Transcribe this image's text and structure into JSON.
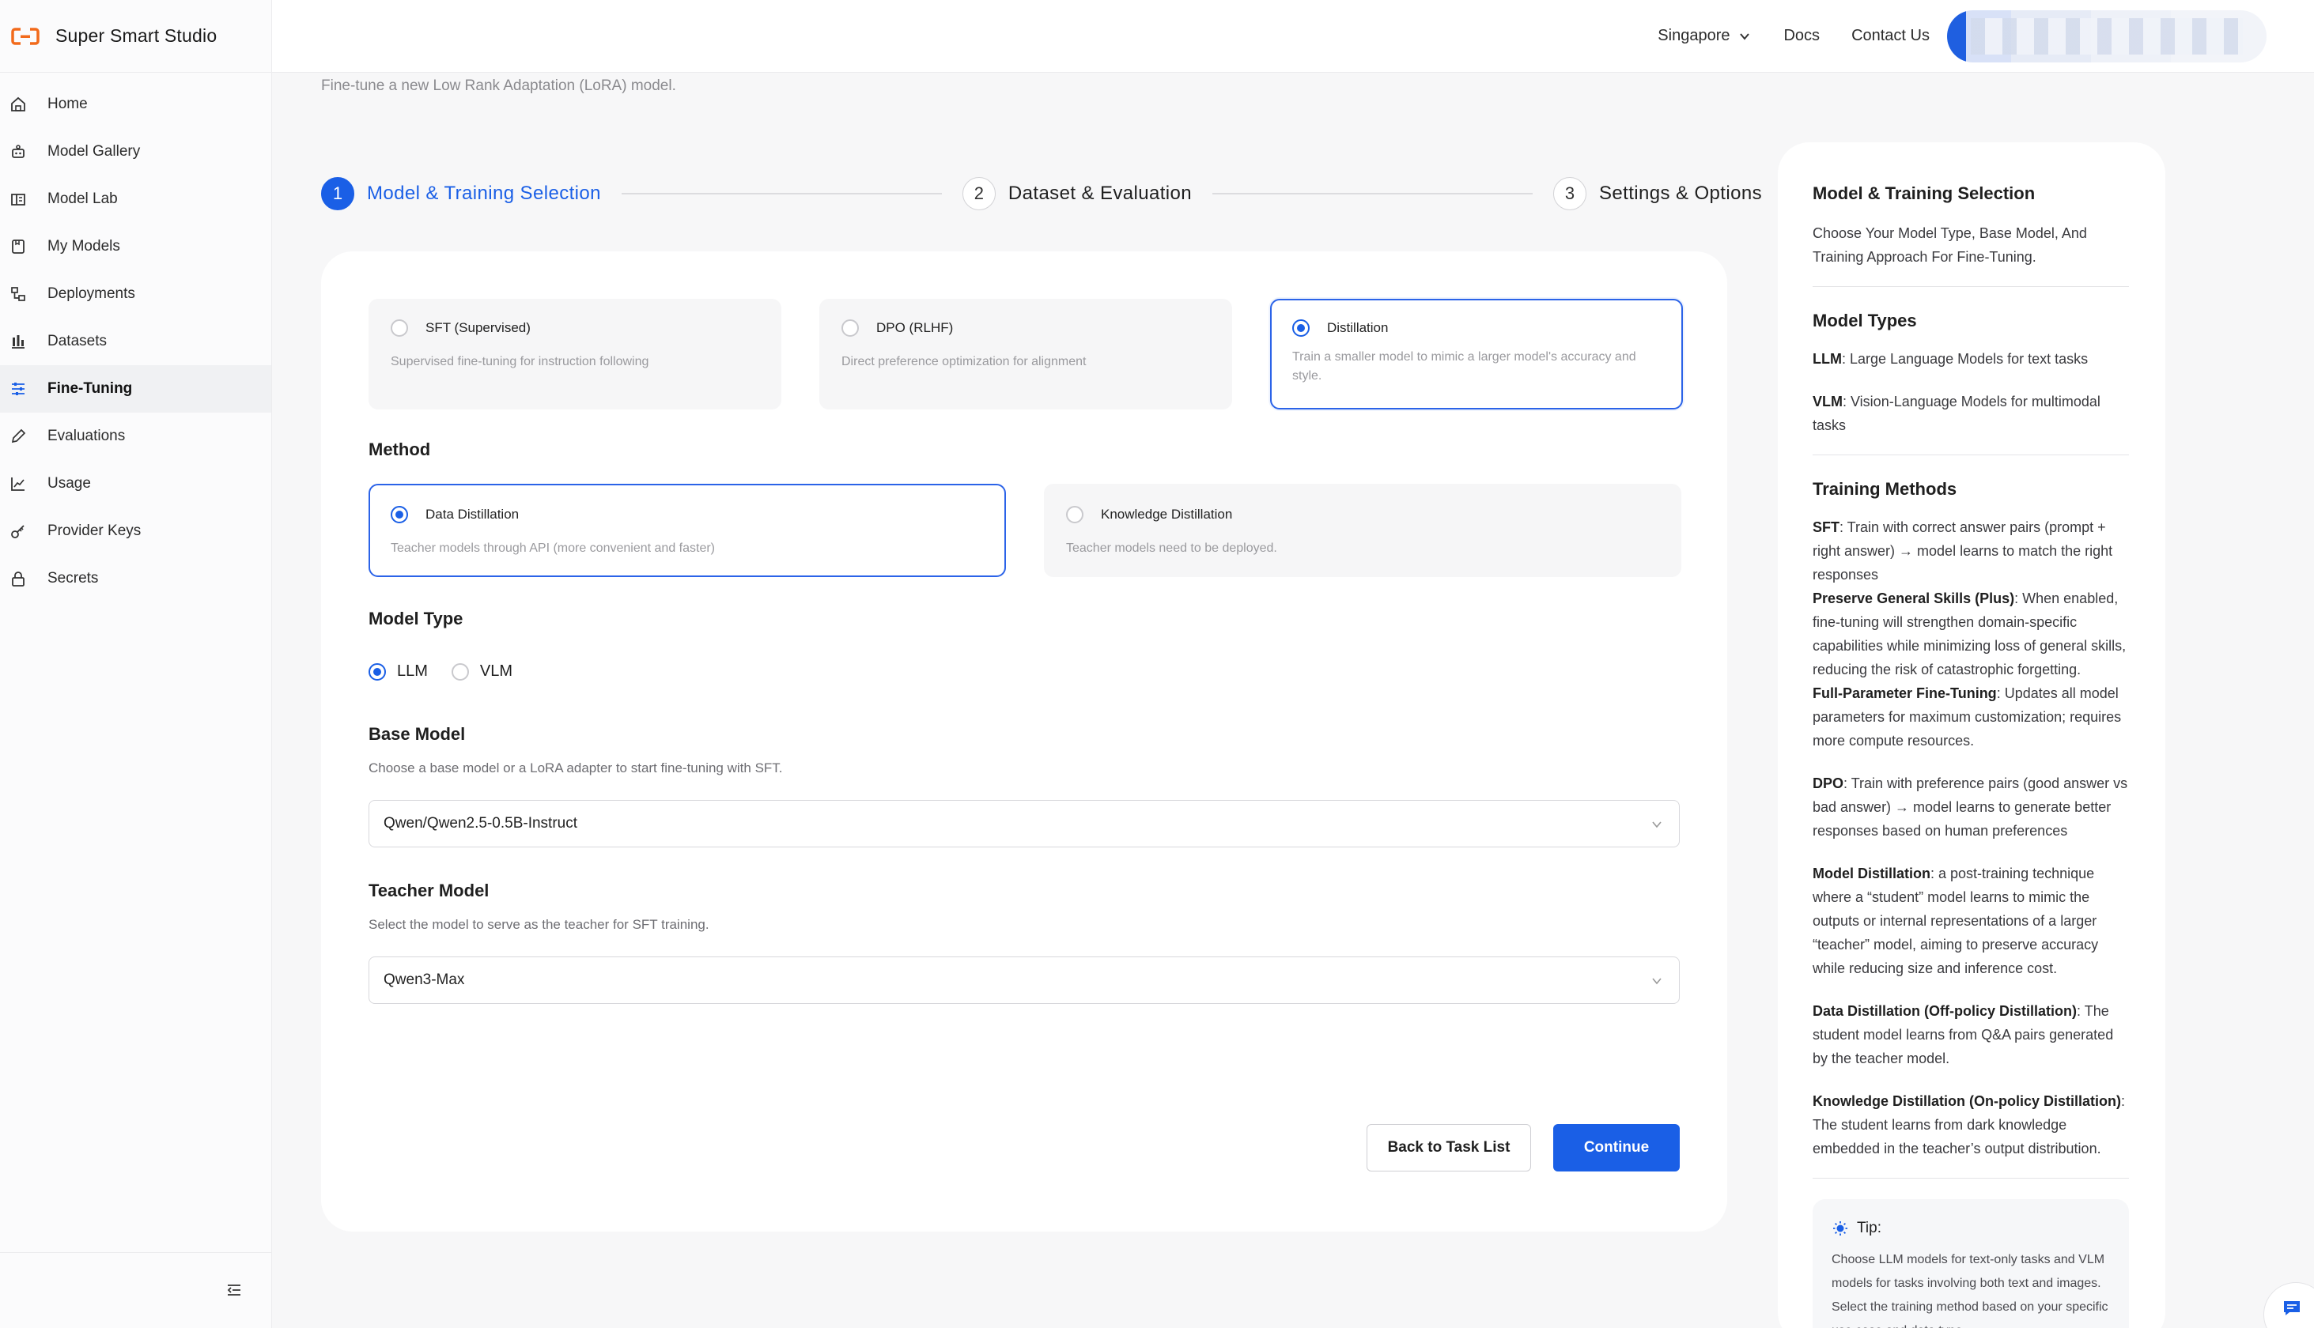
{
  "app": {
    "name": "Super Smart Studio"
  },
  "sidebar": {
    "items": [
      {
        "label": "Home",
        "icon": "home-icon"
      },
      {
        "label": "Model Gallery",
        "icon": "gallery-icon"
      },
      {
        "label": "Model Lab",
        "icon": "lab-icon"
      },
      {
        "label": "My Models",
        "icon": "models-icon"
      },
      {
        "label": "Deployments",
        "icon": "deployments-icon"
      },
      {
        "label": "Datasets",
        "icon": "datasets-icon"
      },
      {
        "label": "Fine-Tuning",
        "icon": "sliders-icon",
        "active": true
      },
      {
        "label": "Evaluations",
        "icon": "pencil-icon"
      },
      {
        "label": "Usage",
        "icon": "chart-icon"
      },
      {
        "label": "Provider Keys",
        "icon": "key-icon"
      },
      {
        "label": "Secrets",
        "icon": "lock-icon"
      }
    ]
  },
  "topbar": {
    "region": "Singapore",
    "docs": "Docs",
    "contact": "Contact Us"
  },
  "main": {
    "subtitle": "Fine-tune a new Low Rank Adaptation (LoRA) model.",
    "steps": [
      {
        "num": "1",
        "label": "Model & Training Selection",
        "active": true
      },
      {
        "num": "2",
        "label": "Dataset & Evaluation"
      },
      {
        "num": "3",
        "label": "Settings & Options"
      }
    ],
    "tasks": [
      {
        "title": "SFT (Supervised)",
        "desc": "Supervised fine-tuning for instruction following",
        "selected": false
      },
      {
        "title": "DPO (RLHF)",
        "desc": "Direct preference optimization for alignment",
        "selected": false
      },
      {
        "title": "Distillation",
        "desc": "Train a smaller model to mimic a larger model's accuracy and style.",
        "selected": true
      }
    ],
    "method": {
      "title": "Method",
      "options": [
        {
          "title": "Data Distillation",
          "desc": "Teacher models through API (more convenient and faster)",
          "selected": true
        },
        {
          "title": "Knowledge Distillation",
          "desc": "Teacher models need to be deployed.",
          "selected": false
        }
      ]
    },
    "model_type": {
      "title": "Model Type",
      "options": [
        {
          "label": "LLM",
          "selected": true
        },
        {
          "label": "VLM",
          "selected": false
        }
      ]
    },
    "base_model": {
      "title": "Base Model",
      "help": "Choose a base model or a LoRA adapter to start fine-tuning with SFT.",
      "value": "Qwen/Qwen2.5-0.5B-Instruct"
    },
    "teacher_model": {
      "title": "Teacher Model",
      "help": "Select the model to serve as the teacher for SFT training.",
      "value": "Qwen3-Max"
    },
    "buttons": {
      "back": "Back to Task List",
      "continue": "Continue"
    }
  },
  "guide": {
    "title": "Model & Training Selection",
    "intro": "Choose Your Model Type, Base Model, And Training Approach For Fine-Tuning.",
    "model_types_title": "Model Types",
    "llm_term": "LLM",
    "llm_desc": ": Large Language Models for text tasks",
    "vlm_term": "VLM",
    "vlm_desc": ": Vision-Language Models for multimodal tasks",
    "methods_title": "Training Methods",
    "sft_term": "SFT",
    "sft_desc": ": Train with correct answer pairs (prompt + right answer) → model learns to match the right responses",
    "pgs_term": "Preserve General Skills (Plus)",
    "pgs_desc": ": When enabled, fine-tuning will strengthen domain-specific capabilities while minimizing loss of general skills, reducing the risk of catastrophic forgetting.",
    "fpft_term": "Full-Parameter Fine-Tuning",
    "fpft_desc": ": Updates all model parameters for maximum customization; requires more compute resources.",
    "dpo_term": "DPO",
    "dpo_desc": ": Train with preference pairs (good answer vs bad answer) → model learns to generate better responses based on human preferences",
    "md_term": "Model Distillation",
    "md_desc": ": a post-training technique where a “student” model learns to mimic the outputs or internal representations of a larger “teacher” model, aiming to preserve accuracy while reducing size and inference cost.",
    "dd_term": "Data Distillation (Off-policy Distillation)",
    "dd_desc": ": The student model learns from Q&A pairs generated by the teacher model.",
    "kd_term": "Knowledge Distillation (On-policy Distillation)",
    "kd_desc": ": The student learns from dark knowledge embedded in the teacher’s output distribution.",
    "tip_title": "Tip:",
    "tip_body": "Choose LLM models for text-only tasks and VLM models for tasks involving both text and images. Select the training method based on your specific use case and data type."
  },
  "colors": {
    "accent": "#1a5fe6",
    "brand": "#f26a1b"
  }
}
